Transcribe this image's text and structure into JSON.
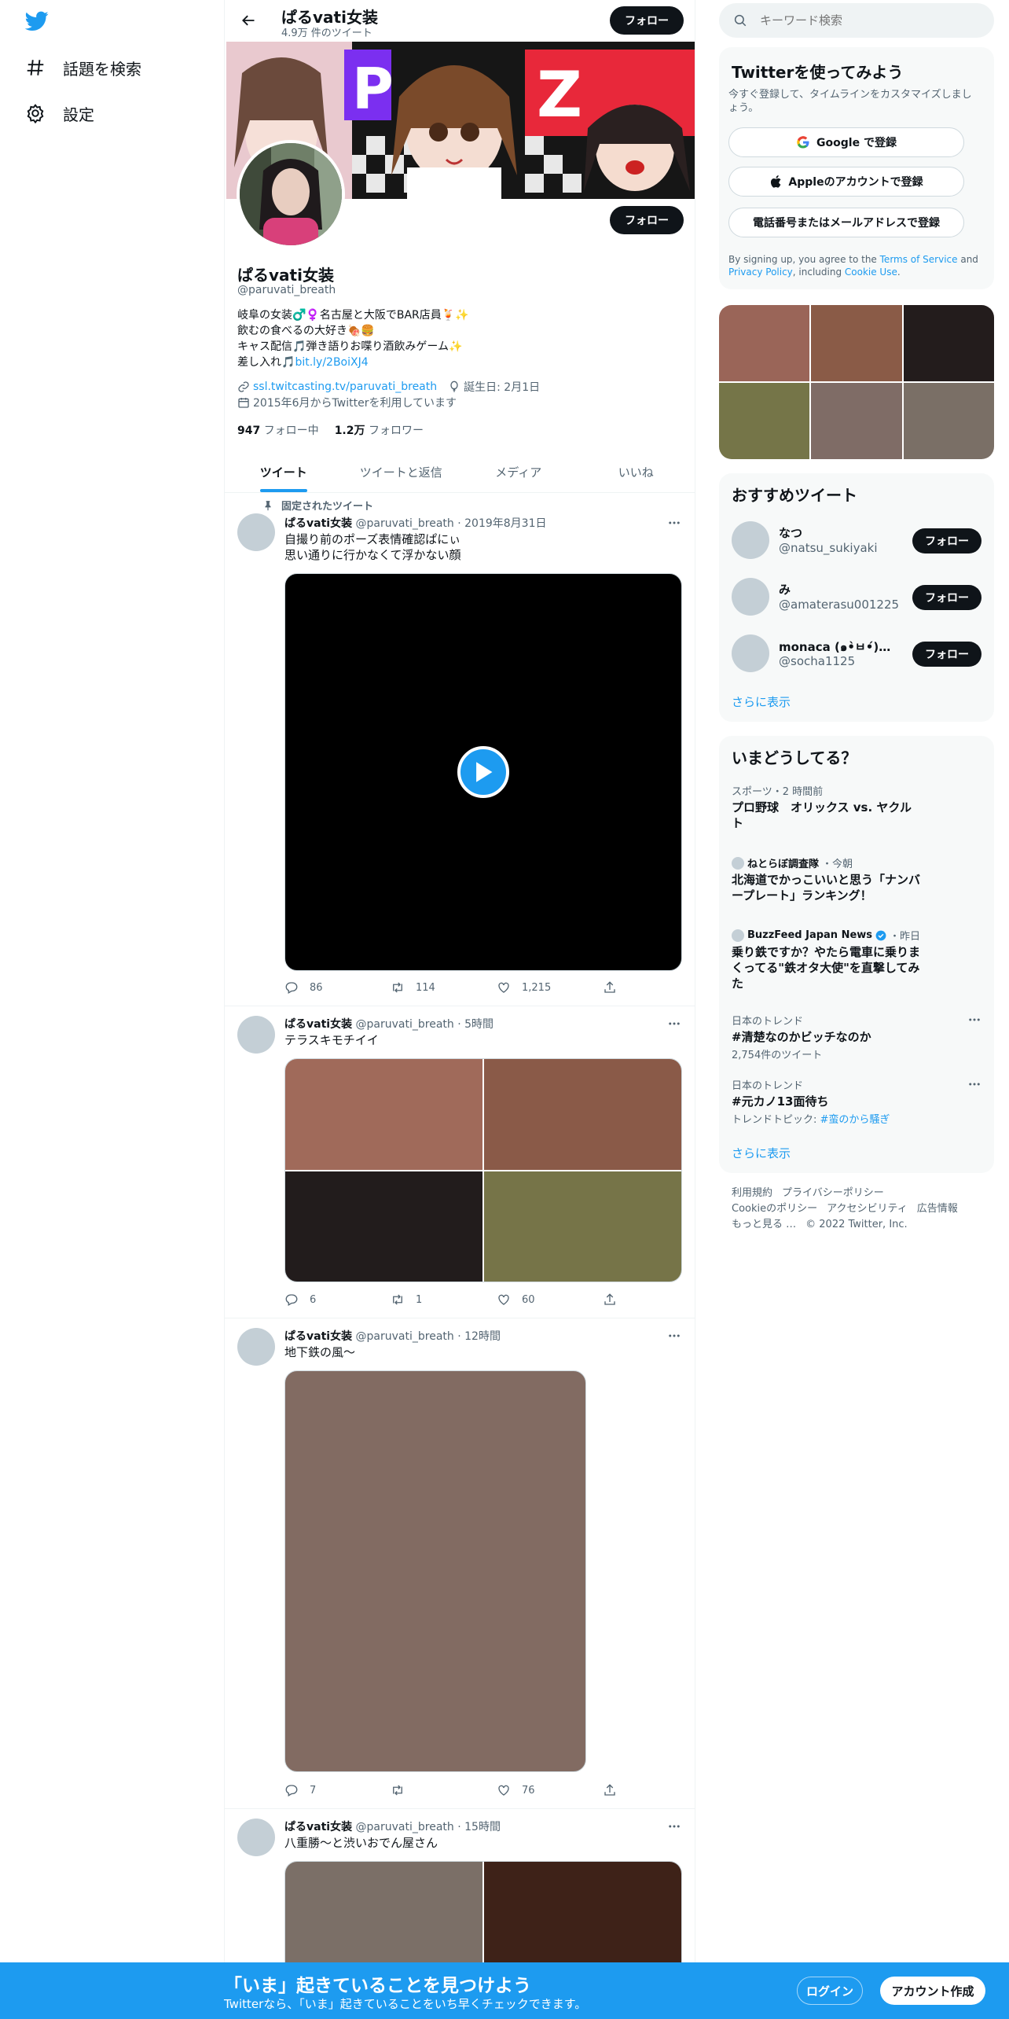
{
  "nav": {
    "explore_label": "話題を検索",
    "settings_label": "設定"
  },
  "header": {
    "name": "ぱるvati女装",
    "tweet_count": "4.9万 件のツイート",
    "follow_label": "フォロー"
  },
  "profile": {
    "name": "ぱるvati女装",
    "handle": "@paruvati_breath",
    "follow_label": "フォロー",
    "bio_lines": [
      "岐阜の女装♂️♀️名古屋と大阪でBAR店員🍹✨",
      "飲むの食べるの大好き🍖🍔",
      "キャス配信🎵弾き語りお喋り酒飲みゲーム✨"
    ],
    "bio_link_prefix": "差し入れ🎵",
    "bio_link": "bit.ly/2BoiXJ4",
    "website": "ssl.twitcasting.tv/paruvati_breath",
    "birthday": "誕生日: 2月1日",
    "joined": "2015年6月からTwitterを利用しています",
    "following_count": "947",
    "following_label": "フォロー中",
    "followers_count": "1.2万",
    "followers_label": "フォロワー"
  },
  "tabs": [
    "ツイート",
    "ツイートと返信",
    "メディア",
    "いいね"
  ],
  "tweets": [
    {
      "pinned_label": "固定されたツイート",
      "name": "ぱるvati女装",
      "handle": "@paruvati_breath",
      "time": "2019年8月31日",
      "lines": [
        "自撮り前のポーズ表情確認ぱにぃ",
        "思い通りに行かなくて浮かない顔"
      ],
      "replies": "86",
      "retweets": "114",
      "likes": "1,215"
    },
    {
      "name": "ぱるvati女装",
      "handle": "@paruvati_breath",
      "time": "5時間",
      "lines": [
        "テラスキモチイイ"
      ],
      "replies": "6",
      "retweets": "1",
      "likes": "60",
      "image_colors": [
        "#a06a5a",
        "#8a5a48",
        "#221c1c",
        "#767448"
      ]
    },
    {
      "name": "ぱるvati女装",
      "handle": "@paruvati_breath",
      "time": "12時間",
      "lines": [
        "地下鉄の風〜"
      ],
      "replies": "7",
      "retweets": "",
      "likes": "76",
      "image_color": "#826b62"
    },
    {
      "name": "ぱるvati女装",
      "handle": "@paruvati_breath",
      "time": "15時間",
      "lines": [
        "八重勝〜と渋いおでん屋さん"
      ],
      "image_colors": [
        "#7b6f67",
        "#3e2218"
      ]
    }
  ],
  "search": {
    "placeholder": "キーワード検索"
  },
  "signup_card": {
    "title": "Twitterを使ってみよう",
    "subtitle": "今すぐ登録して、タイムラインをカスタマイズしましょう。",
    "google_label": "Google で登録",
    "apple_label": "Appleのアカウントで登録",
    "phone_label": "電話番号またはメールアドレスで登録",
    "legal_prefix": "By signing up, you agree to the ",
    "tos": "Terms of Service",
    "and": " and ",
    "privacy": "Privacy Policy",
    "including": ", including ",
    "cookie": "Cookie Use",
    "period": "."
  },
  "photo_colors": [
    "#9a6558",
    "#8a5b47",
    "#231c1c",
    "#757548",
    "#7f6c66",
    "#7a6f66"
  ],
  "recommended": {
    "title": "おすすめツイート",
    "follow_label": "フォロー",
    "show_more": "さらに表示",
    "users": [
      {
        "name": "なつ",
        "handle": "@natsu_sukiyaki"
      },
      {
        "name": "み",
        "handle": "@amaterasu001225"
      },
      {
        "name": "monaca (๑•̀ㅂ•́)و再…",
        "handle": "@socha1125"
      }
    ]
  },
  "trends": {
    "title": "いまどうしてる？",
    "show_more": "さらに表示",
    "items": [
      {
        "context": "スポーツ・2 時間前",
        "title": "プロ野球　オリックス vs. ヤクルト"
      },
      {
        "source": "ねとらぼ調査隊",
        "time": "・今朝",
        "title": "北海道でかっこいいと思う「ナンバープレート」ランキング！"
      },
      {
        "source": "BuzzFeed Japan News",
        "time": "・昨日",
        "title": "乗り鉄ですか？やたら電車に乗りまくってる\"鉄オタ大使\"を直撃してみた"
      },
      {
        "context": "日本のトレンド",
        "title": "#清楚なのかビッチなのか",
        "sub": "2,754件のツイート"
      },
      {
        "context": "日本のトレンド",
        "title": "#元カノ13面待ち",
        "sub_prefix": "トレンドトピック: ",
        "sub_link": "#蛮のから騒ぎ"
      }
    ]
  },
  "footer": {
    "links": [
      "利用規約",
      "プライバシーポリシー",
      "Cookieのポリシー",
      "アクセシビリティ",
      "広告情報",
      "もっと見る …"
    ],
    "copyright": "© 2022 Twitter, Inc."
  },
  "bottom_bar": {
    "title": "「いま」起きていることを見つけよう",
    "subtitle": "Twitterなら、「いま」起きていることをいち早くチェックできます。",
    "login_label": "ログイン",
    "signup_label": "アカウント作成"
  },
  "colors": {
    "accent": "#1d9bf0",
    "text": "#0f1419",
    "muted": "#536471",
    "video_bg": "#000000"
  }
}
